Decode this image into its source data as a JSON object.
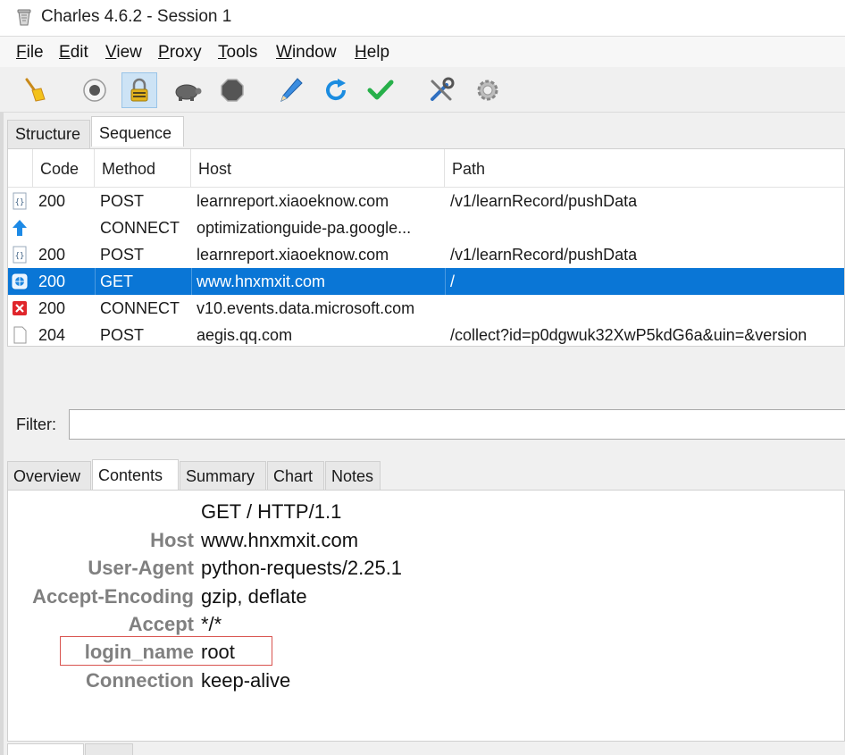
{
  "window": {
    "title": "Charles 4.6.2 - Session 1"
  },
  "menu": {
    "items": [
      {
        "accel": "F",
        "rest": "ile"
      },
      {
        "accel": "E",
        "rest": "dit"
      },
      {
        "accel": "V",
        "rest": "iew"
      },
      {
        "accel": "P",
        "rest": "roxy"
      },
      {
        "accel": "T",
        "rest": "ools"
      },
      {
        "accel": "W",
        "rest": "indow"
      },
      {
        "accel": "H",
        "rest": "elp"
      }
    ]
  },
  "toolbar": {
    "icons": [
      "broom-icon",
      "record-icon",
      "ssl-proxying-lock-icon",
      "throttle-turtle-icon",
      "breakpoints-hexagon-icon",
      "compose-pen-icon",
      "repeat-refresh-icon",
      "validate-check-icon",
      "tools-icon",
      "settings-gear-icon"
    ]
  },
  "view_tabs": {
    "structure": "Structure",
    "sequence": "Sequence"
  },
  "table": {
    "headers": {
      "code": "Code",
      "method": "Method",
      "host": "Host",
      "path": "Path"
    },
    "rows": [
      {
        "icon": "json-doc-icon",
        "code": "200",
        "method": "POST",
        "host": "learnreport.xiaoeknow.com",
        "path": "/v1/learnRecord/pushData"
      },
      {
        "icon": "upload-arrow-icon",
        "code": "",
        "method": "CONNECT",
        "host": "optimizationguide-pa.google...",
        "path": ""
      },
      {
        "icon": "json-doc-icon",
        "code": "200",
        "method": "POST",
        "host": "learnreport.xiaoeknow.com",
        "path": "/v1/learnRecord/pushData"
      },
      {
        "icon": "web-globe-icon",
        "code": "200",
        "method": "GET",
        "host": "www.hnxmxit.com",
        "path": "/"
      },
      {
        "icon": "error-x-icon",
        "code": "200",
        "method": "CONNECT",
        "host": "v10.events.data.microsoft.com",
        "path": ""
      },
      {
        "icon": "blank-doc-icon",
        "code": "204",
        "method": "POST",
        "host": "aegis.qq.com",
        "path": "/collect?id=p0dgwuk32XwP5kdG6a&uin=&version"
      }
    ]
  },
  "filter": {
    "label": "Filter:",
    "value": ""
  },
  "detail_tabs": {
    "overview": "Overview",
    "contents": "Contents",
    "summary": "Summary",
    "chart": "Chart",
    "notes": "Notes"
  },
  "request": {
    "request_line": "GET / HTTP/1.1",
    "headers": [
      {
        "key": "Host",
        "value": "www.hnxmxit.com"
      },
      {
        "key": "User-Agent",
        "value": "python-requests/2.25.1"
      },
      {
        "key": "Accept-Encoding",
        "value": "gzip, deflate"
      },
      {
        "key": "Accept",
        "value": "*/*"
      },
      {
        "key": "login_name",
        "value": "root"
      },
      {
        "key": "Connection",
        "value": "keep-alive"
      }
    ]
  },
  "colors": {
    "selection": "#0a76d6",
    "highlight_box": "#d9534f",
    "header_key": "#808080"
  }
}
